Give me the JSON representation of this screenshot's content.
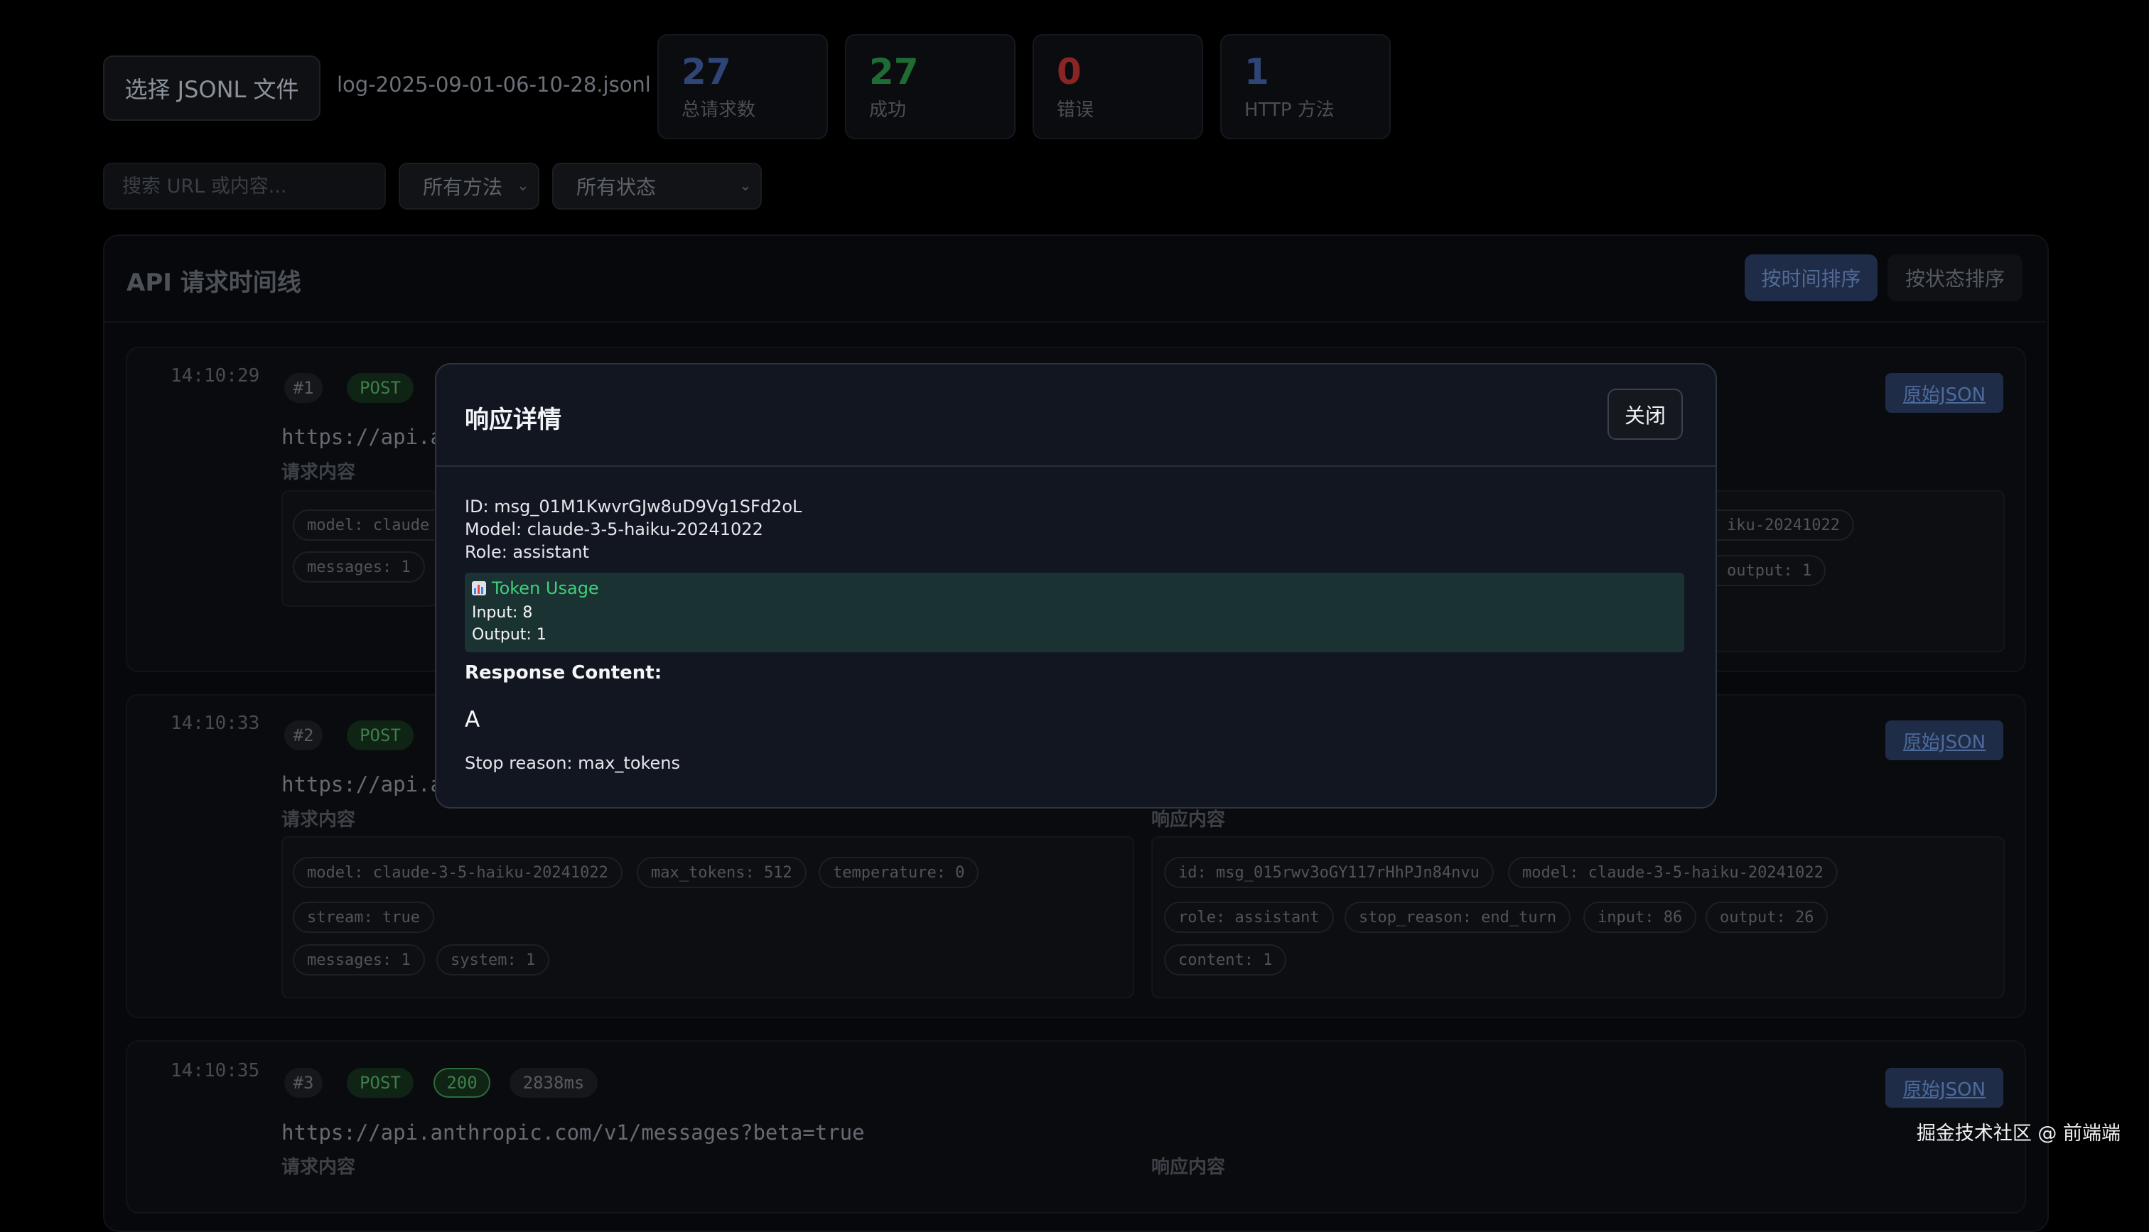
{
  "header": {
    "choose_file_label": "选择 JSONL 文件",
    "file_name": "log-2025-09-01-06-10-28.jsonl",
    "stats": [
      {
        "value": "27",
        "label": "总请求数",
        "color": "#2f4576"
      },
      {
        "value": "27",
        "label": "成功",
        "color": "#1f6b34"
      },
      {
        "value": "0",
        "label": "错误",
        "color": "#8a2523"
      },
      {
        "value": "1",
        "label": "HTTP 方法",
        "color": "#2f4576"
      }
    ]
  },
  "filters": {
    "search_placeholder": "搜索 URL 或内容...",
    "method_select": "所有方法",
    "status_select": "所有状态"
  },
  "timeline": {
    "title": "API 请求时间线",
    "sort_time_label": "按时间排序",
    "sort_status_label": "按状态排序",
    "raw_json_label": "原始JSON",
    "request_label": "请求内容",
    "response_label": "响应内容",
    "entries": [
      {
        "time": "14:10:29",
        "num": "#1",
        "method": "POST",
        "url": "https://api.a",
        "request_chips": [
          "model: claude",
          "messages: 1"
        ],
        "response_chips": [
          "iku-20241022",
          "output: 1"
        ]
      },
      {
        "time": "14:10:33",
        "num": "#2",
        "method": "POST",
        "url": "https://api.a",
        "request_chips": [
          "model: claude-3-5-haiku-20241022",
          "max_tokens: 512",
          "temperature: 0",
          "stream: true",
          "messages: 1",
          "system: 1"
        ],
        "response_chips": [
          "id: msg_015rwv3oGY117rHhPJn84nvu",
          "model: claude-3-5-haiku-20241022",
          "role: assistant",
          "stop_reason: end_turn",
          "input: 86",
          "output: 26",
          "content: 1"
        ]
      },
      {
        "time": "14:10:35",
        "num": "#3",
        "method": "POST",
        "status": "200",
        "duration": "2838ms",
        "url": "https://api.anthropic.com/v1/messages?beta=true"
      }
    ]
  },
  "modal": {
    "title": "响应详情",
    "close_label": "关闭",
    "id_line": "ID: msg_01M1KwvrGJw8uD9Vg1SFd2oL",
    "model_line": "Model: claude-3-5-haiku-20241022",
    "role_line": "Role: assistant",
    "token_usage_title": "Token Usage",
    "input_line": "Input: 8",
    "output_line": "Output: 1",
    "response_content_label": "Response Content:",
    "response_content": "A",
    "stop_reason_line": "Stop reason: max_tokens"
  },
  "watermark": "掘金技术社区 @ 前端端"
}
